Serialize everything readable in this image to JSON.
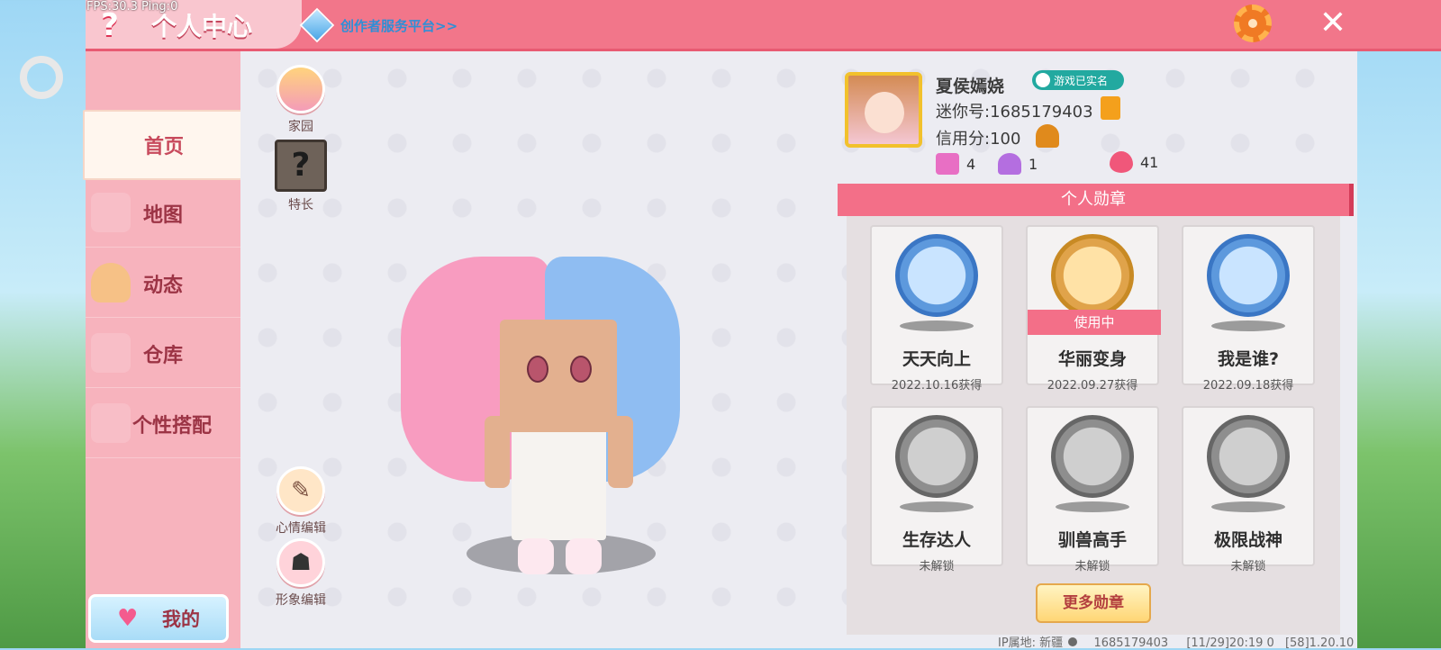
{
  "debug": {
    "fps": "FPS:30.3  Ping:0"
  },
  "header": {
    "help_icon": "?",
    "title": "个人中心",
    "creator_link": "创作者服务平台>>",
    "close_icon": "✕"
  },
  "sidebar": {
    "items": [
      {
        "label": "首页",
        "active": true
      },
      {
        "label": "地图"
      },
      {
        "label": "动态"
      },
      {
        "label": "仓库"
      },
      {
        "label": "个性搭配"
      }
    ],
    "my_button": "我的"
  },
  "left_actions": {
    "home": "家园",
    "skill": "特长",
    "skill_icon": "?",
    "mood_edit": "心情编辑",
    "look_edit": "形象编辑"
  },
  "profile": {
    "name": "夏侯嫣娆",
    "verified": "游戏已实名",
    "mini_id": "迷你号:1685179403",
    "credit": "信用分:100",
    "stats": [
      {
        "icon": "plus-box-icon",
        "value": "4",
        "color": "#e86fc4"
      },
      {
        "icon": "cheer-icon",
        "value": "1",
        "color": "#b46ee0"
      },
      {
        "icon": "flame-icon",
        "value": "41",
        "color": "#f0577a"
      }
    ]
  },
  "badges": {
    "header": "个人勋章",
    "items": [
      {
        "name": "天天向上",
        "date": "2022.10.16获得",
        "style": "blue"
      },
      {
        "name": "华丽变身",
        "date": "2022.09.27获得",
        "style": "gold",
        "in_use": "使用中"
      },
      {
        "name": "我是谁?",
        "date": "2022.09.18获得",
        "style": "blue"
      },
      {
        "name": "生存达人",
        "date": "未解锁",
        "style": "gray"
      },
      {
        "name": "驯兽高手",
        "date": "未解锁",
        "style": "gray"
      },
      {
        "name": "极限战神",
        "date": "未解锁",
        "style": "gray"
      }
    ],
    "more_button": "更多勋章"
  },
  "footer": {
    "ip": "IP属地: 新疆",
    "id": "1685179403",
    "time": "[11/29]20:19 0",
    "extra": "[58]1.20.10"
  }
}
